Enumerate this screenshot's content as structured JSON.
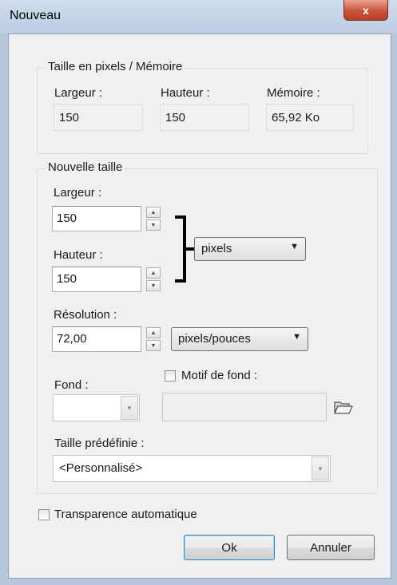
{
  "window": {
    "title": "Nouveau",
    "close_label": "x"
  },
  "pixel_size": {
    "group_title": "Taille en pixels / Mémoire",
    "width_label": "Largeur :",
    "width_value": "150",
    "height_label": "Hauteur :",
    "height_value": "150",
    "memory_label": "Mémoire :",
    "memory_value": "65,92 Ko"
  },
  "new_size": {
    "group_title": "Nouvelle taille",
    "width_label": "Largeur :",
    "width_value": "150",
    "height_label": "Hauteur :",
    "height_value": "150",
    "unit_select": "pixels",
    "resolution_label": "Résolution :",
    "resolution_value": "72,00",
    "resolution_unit_select": "pixels/pouces",
    "background_label": "Fond :",
    "pattern_checkbox_label": "Motif de fond :",
    "pattern_checked": false,
    "preset_label": "Taille prédéfinie :",
    "preset_value": "<Personnalisé>"
  },
  "auto_transparency": {
    "label": "Transparence automatique",
    "checked": false
  },
  "buttons": {
    "ok": "Ok",
    "cancel": "Annuler"
  },
  "icons": {
    "close": "close-icon",
    "spin_up": "spin-up-icon",
    "spin_down": "spin-down-icon",
    "dropdown": "dropdown-arrow-icon",
    "folder": "open-folder-icon"
  }
}
